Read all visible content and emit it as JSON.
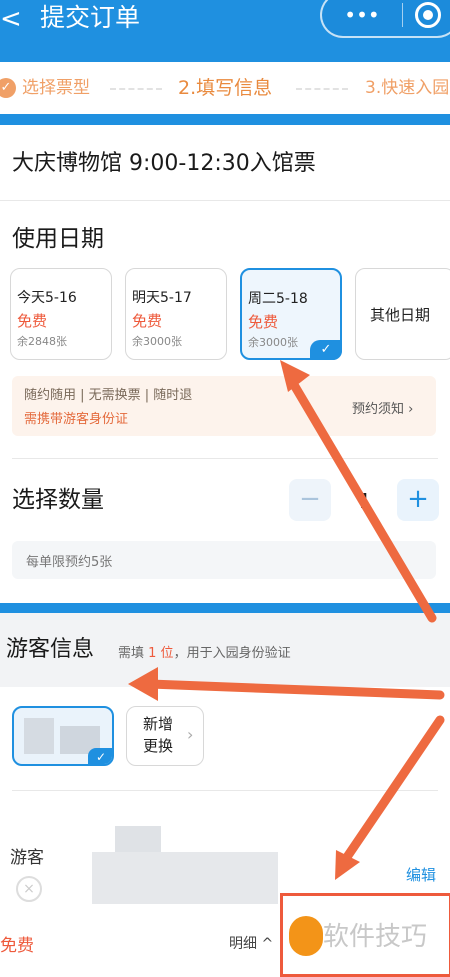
{
  "header": {
    "back_glyph": "<",
    "title": "提交订单",
    "more_glyph": "•••"
  },
  "steps": {
    "step1": "选择票型",
    "step2": "2.填写信息",
    "step3": "3.快速入园",
    "check_glyph": "✓"
  },
  "ticket": {
    "name": "大庆博物馆 9:00-12:30入馆票"
  },
  "date_section": {
    "heading": "使用日期",
    "options": [
      {
        "label": "今天5-16",
        "price": "免费",
        "remaining": "余2848张",
        "selected": false
      },
      {
        "label": "明天5-17",
        "price": "免费",
        "remaining": "余3000张",
        "selected": false
      },
      {
        "label": "周二5-18",
        "price": "免费",
        "remaining": "余3000张",
        "selected": true
      }
    ],
    "other_label": "其他日期",
    "check_glyph": "✓"
  },
  "notice": {
    "tags": "随约随用  |  无需换票  |  随时退",
    "warning": "需携带游客身份证",
    "link": "预约须知 ›"
  },
  "quantity": {
    "label": "选择数量",
    "minus": "−",
    "value": "1",
    "plus": "+",
    "limit": "每单限预约5张"
  },
  "guest": {
    "title": "游客信息",
    "sub_prefix": "需填",
    "sub_count": "1 位",
    "sub_suffix": "，用于入园身份验证",
    "add_line1": "新增",
    "add_line2": "更换",
    "add_chevron": "›",
    "row_label": "游客",
    "remove_glyph": "×",
    "edit": "编辑",
    "check_glyph": "✓"
  },
  "footer": {
    "price": "免费",
    "detail": "明细 ^"
  },
  "watermark": {
    "text": "软件技巧"
  },
  "colors": {
    "brand_blue": "#1f90e0",
    "orange": "#f0a067",
    "price_red": "#ee5a3c",
    "arrow": "#ee6a40"
  }
}
